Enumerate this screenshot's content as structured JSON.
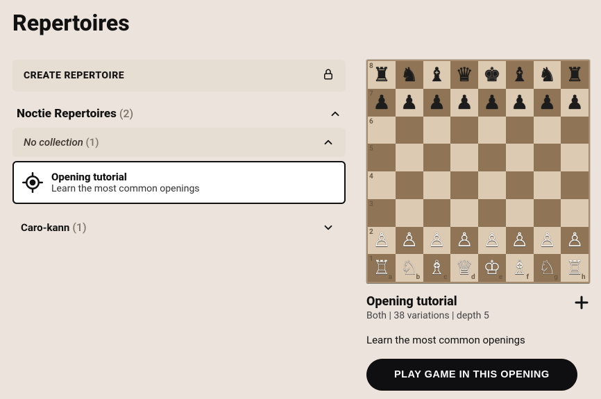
{
  "page_title": "Repertoires",
  "create_label": "CREATE REPERTOIRE",
  "section": {
    "title": "Noctie Repertoires",
    "count": "(2)"
  },
  "subsection": {
    "title": "No collection",
    "count": "(1)"
  },
  "card": {
    "title": "Opening tutorial",
    "subtitle": "Learn the most common openings"
  },
  "row": {
    "name": "Caro-kann",
    "count": "(1)"
  },
  "detail": {
    "title": "Opening tutorial",
    "meta": "Both | 38 variations | depth 5",
    "description": "Learn the most common openings",
    "play_label": "PLAY GAME IN THIS OPENING"
  },
  "board": {
    "files": [
      "a",
      "b",
      "c",
      "d",
      "e",
      "f",
      "g",
      "h"
    ],
    "ranks": [
      "8",
      "7",
      "6",
      "5",
      "4",
      "3",
      "2",
      "1"
    ],
    "position": [
      [
        "♜",
        "♞",
        "♝",
        "♛",
        "♚",
        "♝",
        "♞",
        "♜"
      ],
      [
        "♟",
        "♟",
        "♟",
        "♟",
        "♟",
        "♟",
        "♟",
        "♟"
      ],
      [
        "",
        "",
        "",
        "",
        "",
        "",
        "",
        ""
      ],
      [
        "",
        "",
        "",
        "",
        "",
        "",
        "",
        ""
      ],
      [
        "",
        "",
        "",
        "",
        "",
        "",
        "",
        ""
      ],
      [
        "",
        "",
        "",
        "",
        "",
        "",
        "",
        ""
      ],
      [
        "♙",
        "♙",
        "♙",
        "♙",
        "♙",
        "♙",
        "♙",
        "♙"
      ],
      [
        "♖",
        "♘",
        "♗",
        "♕",
        "♔",
        "♗",
        "♘",
        "♖"
      ]
    ]
  }
}
